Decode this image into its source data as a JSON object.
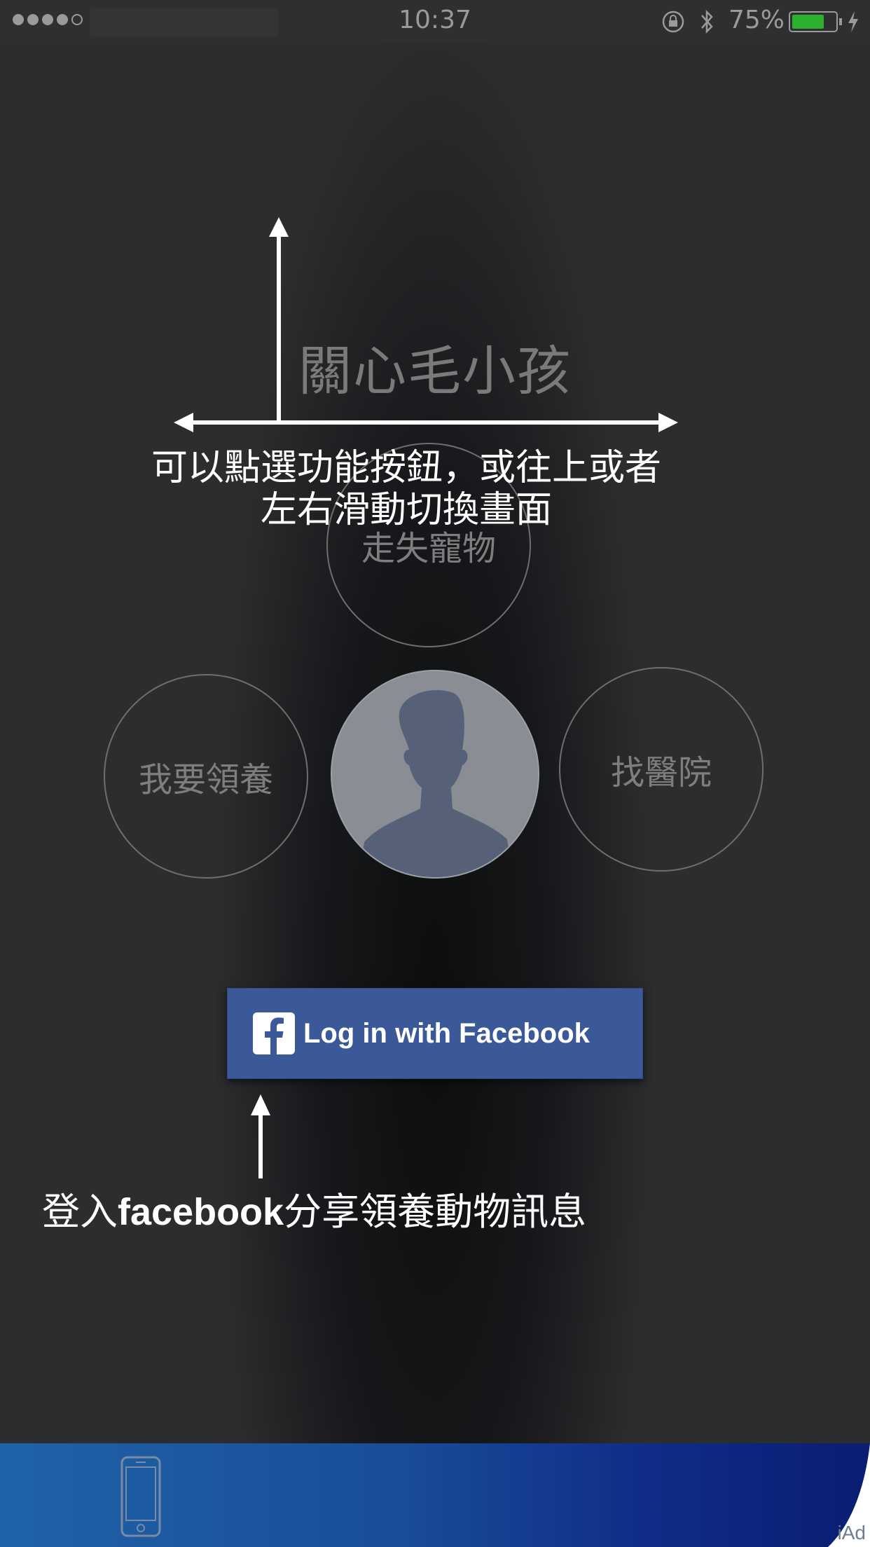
{
  "status_bar": {
    "time": "10:37",
    "battery_percent": "75%",
    "battery_level": 0.75,
    "signal_bars": 4,
    "signal_max": 5,
    "icons": [
      "orientation-lock-icon",
      "bluetooth-icon",
      "battery-icon",
      "charging-bolt-icon"
    ]
  },
  "app": {
    "title": "關心毛小孩"
  },
  "menu": {
    "lost_pets": "走失寵物",
    "adopt": "我要領養",
    "find_hospital": "找醫院",
    "avatar_icon": "profile-silhouette-icon"
  },
  "hints": {
    "navigate": "可以點選功能按鈕，或往上或者\n左右滑動切換畫面",
    "facebook_prefix": "登入",
    "facebook_bold": "facebook",
    "facebook_suffix": "分享領養動物訊息"
  },
  "facebook_button": {
    "label": "Log in with Facebook",
    "color": "#3b5898"
  },
  "ad_banner": {
    "label": "iAd",
    "icon": "iphone-icon"
  }
}
